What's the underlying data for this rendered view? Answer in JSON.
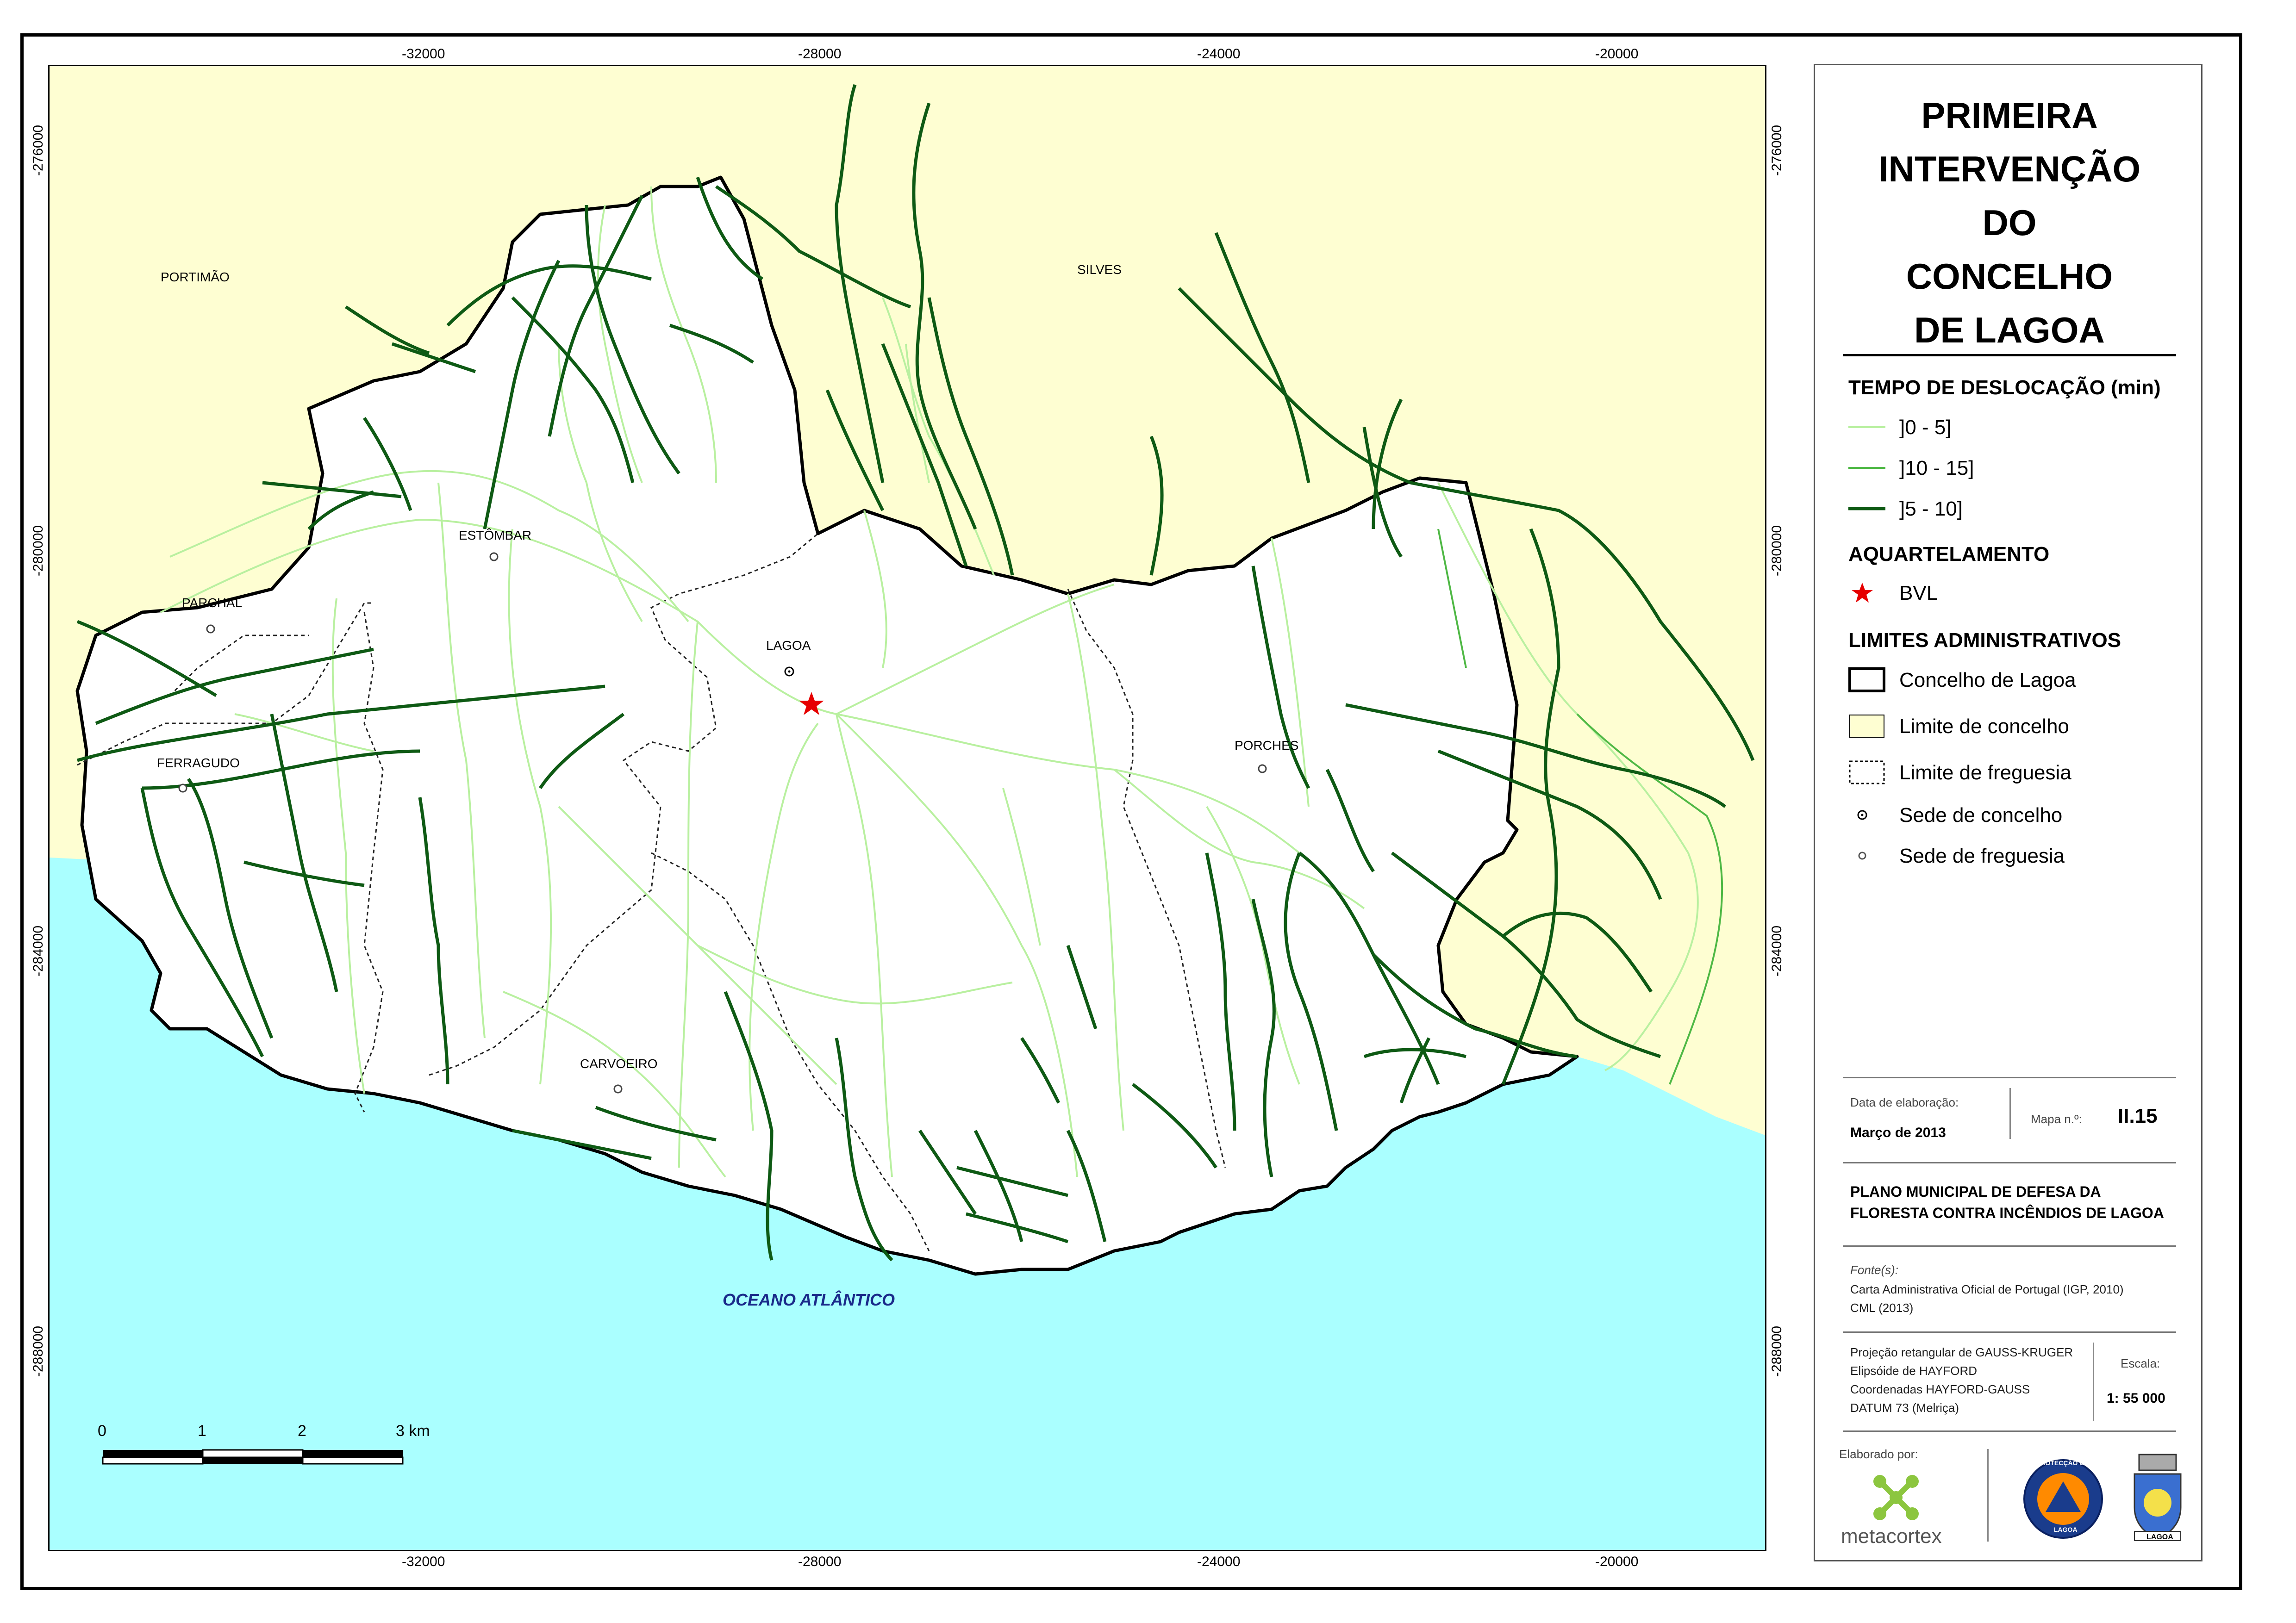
{
  "title_lines": [
    "PRIMEIRA",
    "INTERVENÇÃO",
    "DO",
    "CONCELHO",
    "DE LAGOA"
  ],
  "legend": {
    "travel_time_heading": "TEMPO DE DESLOCAÇÃO (min)",
    "travel_time_items": [
      {
        "label": "]0 - 5]",
        "color": "#b9f0a0"
      },
      {
        "label": "]10 - 15]",
        "color": "#4fb845"
      },
      {
        "label": "]5 - 10]",
        "color": "#0e5a14"
      }
    ],
    "station_heading": "AQUARTELAMENTO",
    "station_item": {
      "label": "BVL",
      "color": "#e60000"
    },
    "limits_heading": "LIMITES ADMINISTRATIVOS",
    "limits_items": [
      {
        "label": "Concelho de Lagoa"
      },
      {
        "label": "Limite de concelho",
        "color": "#fefed2"
      },
      {
        "label": "Limite de freguesia"
      },
      {
        "label": "Sede de concelho"
      },
      {
        "label": "Sede de freguesia"
      }
    ]
  },
  "info": {
    "date_label": "Data de elaboração:",
    "date_value": "Março de 2013",
    "map_no_label": "Mapa n.º:",
    "map_no_value": "II.15",
    "plan_lines": [
      "PLANO MUNICIPAL DE DEFESA DA",
      "FLORESTA CONTRA INCÊNDIOS DE LAGOA"
    ],
    "sources_label": "Fonte(s):",
    "sources_lines": [
      "Carta Administrativa Oficial de Portugal (IGP, 2010)",
      "CML (2013)"
    ],
    "projection_lines": [
      "Projeção retangular de GAUSS-KRUGER",
      "Elipsóide de HAYFORD",
      "Coordenadas HAYFORD-GAUSS",
      "DATUM 73 (Melriça)"
    ],
    "scale_label": "Escala:",
    "scale_value": "1: 55 000",
    "made_by_label": "Elaborado por:",
    "made_by_company": "metacortex",
    "logo_civil_text": "PROTECÇÃO CIVIL",
    "logo_lagoa_text": "LAGOA"
  },
  "map": {
    "x_ticks": [
      "-32000",
      "-28000",
      "-24000",
      "-20000"
    ],
    "y_ticks": [
      "-276000",
      "-280000",
      "-284000",
      "-288000"
    ],
    "places": {
      "portimao": "PORTIMÃO",
      "silves": "SILVES",
      "estombar": "ESTÔMBAR",
      "parchal": "PARCHAL",
      "lagoa": "LAGOA",
      "ferragudo": "FERRAGUDO",
      "porches": "PORCHES",
      "carvoeiro": "CARVOEIRO"
    },
    "ocean": "OCEANO ATLÂNTICO",
    "scale_bar_labels": [
      "0",
      "1",
      "2",
      "3 km"
    ],
    "colors": {
      "land_outside": "#fefed2",
      "sea": "#aaffff",
      "concelho": "#ffffff"
    }
  }
}
